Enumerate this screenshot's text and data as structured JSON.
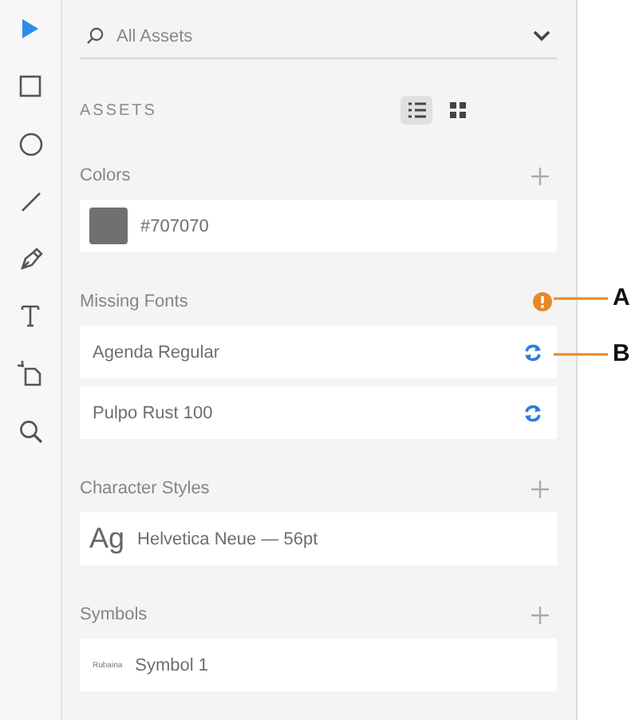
{
  "tools": [
    {
      "kind": "select",
      "selected": true
    },
    {
      "kind": "rectangle",
      "selected": false
    },
    {
      "kind": "ellipse",
      "selected": false
    },
    {
      "kind": "line",
      "selected": false
    },
    {
      "kind": "pen",
      "selected": false
    },
    {
      "kind": "text",
      "selected": false
    },
    {
      "kind": "artboard",
      "selected": false
    },
    {
      "kind": "zoom",
      "selected": false
    }
  ],
  "search": {
    "value": "All Assets"
  },
  "assets_title": "ASSETS",
  "views": [
    {
      "kind": "list",
      "selected": true
    },
    {
      "kind": "grid",
      "selected": false
    }
  ],
  "sections": [
    {
      "title": "Colors",
      "kind": "addable",
      "items": [
        {
          "kind": "color",
          "color": "#707070",
          "label": "#707070"
        }
      ]
    },
    {
      "title": "Missing Fonts",
      "kind": "warning",
      "items": [
        {
          "kind": "missing_font",
          "label": "Agenda Regular"
        },
        {
          "kind": "missing_font",
          "label": "Pulpo Rust 100"
        }
      ]
    },
    {
      "title": "Character Styles",
      "kind": "addable",
      "items": [
        {
          "kind": "char_style",
          "preview": "Ag",
          "label": "Helvetica Neue — 56pt"
        }
      ]
    },
    {
      "title": "Symbols",
      "kind": "addable",
      "items": [
        {
          "kind": "symbol",
          "preview": "Rubaina",
          "label": "Symbol 1"
        }
      ]
    }
  ],
  "callouts": [
    {
      "label": "A"
    },
    {
      "label": "B"
    }
  ]
}
